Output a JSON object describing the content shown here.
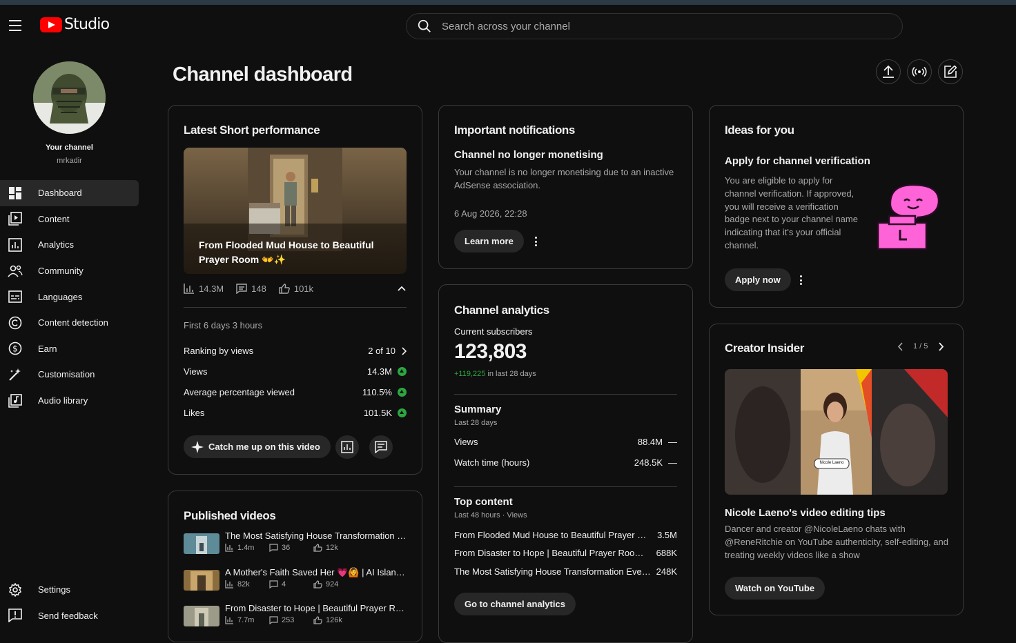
{
  "app": {
    "logo_text": "Studio"
  },
  "search": {
    "placeholder": "Search across your channel"
  },
  "channel": {
    "label": "Your channel",
    "handle": "mrkadir"
  },
  "sidebar": {
    "items": [
      {
        "label": "Dashboard",
        "icon": "dashboard-icon",
        "active": true
      },
      {
        "label": "Content",
        "icon": "content-icon"
      },
      {
        "label": "Analytics",
        "icon": "analytics-icon"
      },
      {
        "label": "Community",
        "icon": "community-icon"
      },
      {
        "label": "Languages",
        "icon": "languages-icon"
      },
      {
        "label": "Content detection",
        "icon": "content-detection-icon"
      },
      {
        "label": "Earn",
        "icon": "earn-icon"
      },
      {
        "label": "Customisation",
        "icon": "customisation-icon"
      },
      {
        "label": "Audio library",
        "icon": "audio-library-icon"
      }
    ],
    "bottom": [
      {
        "label": "Settings",
        "icon": "gear-icon"
      },
      {
        "label": "Send feedback",
        "icon": "feedback-icon"
      }
    ]
  },
  "page": {
    "title": "Channel dashboard"
  },
  "top_actions": [
    "upload-icon",
    "live-icon",
    "create-post-icon"
  ],
  "latest_short": {
    "title": "Latest Short performance",
    "video_title": "From Flooded Mud House to Beautiful Prayer Room 👐✨",
    "views": "14.3M",
    "comments": "148",
    "likes": "101k",
    "period": "First 6 days 3 hours",
    "metrics": [
      {
        "label": "Ranking by views",
        "value": "2 of 10"
      },
      {
        "label": "Views",
        "value": "14.3M"
      },
      {
        "label": "Average percentage viewed",
        "value": "110.5%"
      },
      {
        "label": "Likes",
        "value": "101.5K"
      }
    ],
    "catch_up_label": "Catch me up on this video"
  },
  "published": {
    "title": "Published videos",
    "videos": [
      {
        "title": "The Most Satisfying House Transformation Ever...",
        "views": "1.4m",
        "comments": "36",
        "likes": "12k"
      },
      {
        "title": "A Mother's Faith Saved Her 💗🙆 | AI Island...",
        "views": "82k",
        "comments": "4",
        "likes": "924"
      },
      {
        "title": "From Disaster to Hope | Beautiful Prayer Room...",
        "views": "7.7m",
        "comments": "253",
        "likes": "126k"
      }
    ]
  },
  "notifications": {
    "title": "Important notifications",
    "heading": "Channel no longer monetising",
    "body": "Your channel is no longer monetising due to an inactive AdSense association.",
    "date": "6 Aug 2026, 22:28",
    "button": "Learn more"
  },
  "analytics": {
    "title": "Channel analytics",
    "subs_label": "Current subscribers",
    "subs": "123,803",
    "subs_delta": "+119,225",
    "subs_delta_suffix": "in last 28 days",
    "summary_title": "Summary",
    "summary_period": "Last 28 days",
    "summary": [
      {
        "label": "Views",
        "value": "88.4M",
        "trend": "—"
      },
      {
        "label": "Watch time (hours)",
        "value": "248.5K",
        "trend": "—"
      }
    ],
    "top_title": "Top content",
    "top_period": "Last 48 hours · Views",
    "top": [
      {
        "title": "From Flooded Mud House to Beautiful Prayer Room",
        "value": "3.5M"
      },
      {
        "title": "From Disaster to Hope | Beautiful Prayer Room ...",
        "value": "688K"
      },
      {
        "title": "The Most Satisfying House Transformation Ever...",
        "value": "248K"
      }
    ],
    "button": "Go to channel analytics"
  },
  "ideas": {
    "title": "Ideas for you",
    "heading": "Apply for channel verification",
    "body": "You are eligible to apply for channel verification. If approved, you will receive a verification badge next to your channel name indicating that it's your official channel.",
    "button": "Apply now"
  },
  "insider": {
    "title": "Creator Insider",
    "pager": "1 / 5",
    "heading": "Nicole Laeno's video editing tips",
    "body": "Dancer and creator @NicoleLaeno chats with @ReneRitchie on YouTube authenticity, self-editing, and treating weekly videos like a show",
    "button": "Watch on YouTube",
    "name_tag": "Nicole Laeno"
  },
  "colors": {
    "accent_red": "#ff0000",
    "positive_green": "#2ba640",
    "pink": "#ff63d8"
  }
}
